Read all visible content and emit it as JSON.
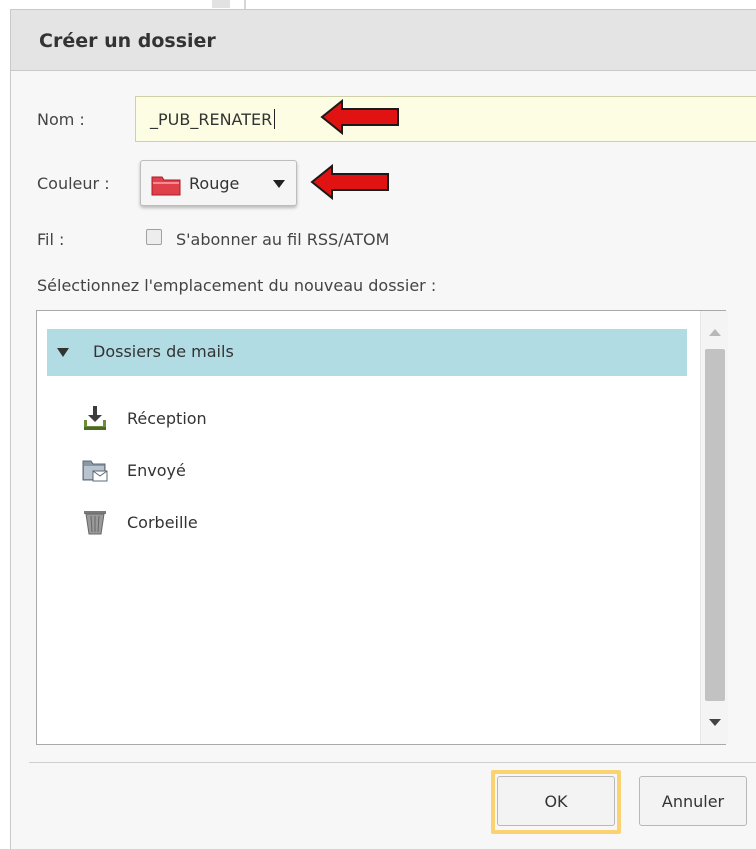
{
  "dialog": {
    "title": "Créer un dossier",
    "name_label": "Nom :",
    "name_value": "_PUB_RENATER",
    "color_label": "Couleur :",
    "color_value": "Rouge",
    "color_swatch": "#e0404a",
    "feed_label": "Fil :",
    "feed_checkbox_label": "S'abonner au fil RSS/ATOM",
    "feed_checked": false,
    "location_label": "Sélectionnez l'emplacement du nouveau dossier :"
  },
  "tree": {
    "root": {
      "label": "Dossiers de mails",
      "expanded": true,
      "highlight_color": "#b1dce3"
    },
    "items": [
      {
        "label": "Réception",
        "icon": "inbox-download-icon"
      },
      {
        "label": "Envoyé",
        "icon": "sent-folder-icon"
      },
      {
        "label": "Corbeille",
        "icon": "trash-icon"
      }
    ]
  },
  "buttons": {
    "ok_label": "OK",
    "cancel_label": "Annuler",
    "focus_color": "#fbd271"
  },
  "annotations": {
    "arrow_color": "#e11212"
  }
}
